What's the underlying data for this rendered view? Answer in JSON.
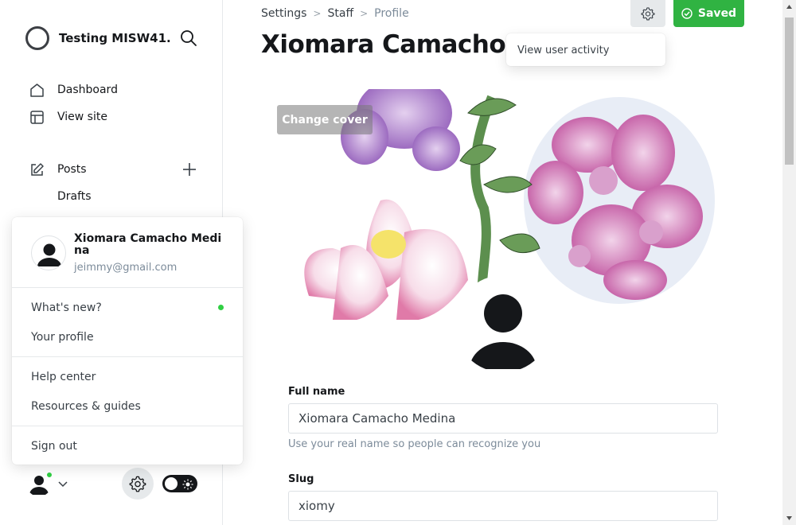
{
  "site": {
    "title": "Testing MISW41..."
  },
  "sidebar": {
    "items": [
      {
        "label": "Dashboard",
        "icon": "home-icon"
      },
      {
        "label": "View site",
        "icon": "layout-icon"
      },
      {
        "label": "Posts",
        "icon": "edit-icon"
      },
      {
        "label": "Drafts",
        "icon": ""
      }
    ]
  },
  "user_menu": {
    "name": "Xiomara Camacho Medina",
    "email": "jeimmy@gmail.com",
    "items": [
      "What's new?",
      "Your profile",
      "Help center",
      "Resources & guides",
      "Sign out"
    ]
  },
  "breadcrumb": {
    "settings": "Settings",
    "staff": "Staff",
    "current": "Profile"
  },
  "page": {
    "title": "Xiomara Camacho Medina"
  },
  "actions": {
    "saved": "Saved",
    "dropdown_item": "View user activity"
  },
  "cover": {
    "change_label": "Change cover"
  },
  "form": {
    "full_name": {
      "label": "Full name",
      "value": "Xiomara Camacho Medina",
      "hint": "Use your real name so people can recognize you"
    },
    "slug": {
      "label": "Slug",
      "value": "xiomy"
    }
  },
  "colors": {
    "accent_green": "#30b342",
    "online_dot": "#30cf43"
  }
}
